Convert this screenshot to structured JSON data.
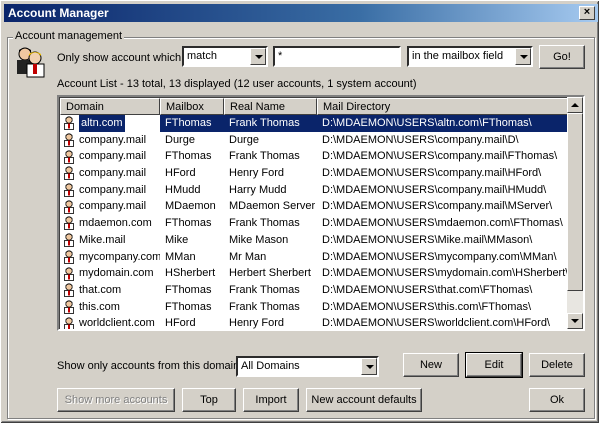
{
  "window": {
    "title": "Account Manager",
    "close_glyph": "×"
  },
  "group_title": "Account management",
  "filter": {
    "label": "Only show account which",
    "match_value": "match",
    "pattern_value": "*",
    "field_value": "in the mailbox field",
    "go_label": "Go!"
  },
  "list": {
    "summary": "Account List - 13 total, 13 displayed (12 user accounts, 1 system account)",
    "columns": [
      "Domain",
      "Mailbox",
      "Real Name",
      "Mail Directory"
    ],
    "rows": [
      {
        "domain": "altn.com",
        "mailbox": "FThomas",
        "name": "Frank Thomas",
        "dir": "D:\\MDAEMON\\USERS\\altn.com\\FThomas\\"
      },
      {
        "domain": "company.mail",
        "mailbox": "Durge",
        "name": "Durge",
        "dir": "D:\\MDAEMON\\USERS\\company.mail\\D\\"
      },
      {
        "domain": "company.mail",
        "mailbox": "FThomas",
        "name": "Frank Thomas",
        "dir": "D:\\MDAEMON\\USERS\\company.mail\\FThomas\\"
      },
      {
        "domain": "company.mail",
        "mailbox": "HFord",
        "name": "Henry Ford",
        "dir": "D:\\MDAEMON\\USERS\\company.mail\\HFord\\"
      },
      {
        "domain": "company.mail",
        "mailbox": "HMudd",
        "name": "Harry Mudd",
        "dir": "D:\\MDAEMON\\USERS\\company.mail\\HMudd\\"
      },
      {
        "domain": "company.mail",
        "mailbox": "MDaemon",
        "name": "MDaemon Server",
        "dir": "D:\\MDAEMON\\USERS\\company.mail\\MServer\\"
      },
      {
        "domain": "mdaemon.com",
        "mailbox": "FThomas",
        "name": "Frank Thomas",
        "dir": "D:\\MDAEMON\\USERS\\mdaemon.com\\FThomas\\"
      },
      {
        "domain": "Mike.mail",
        "mailbox": "Mike",
        "name": "Mike Mason",
        "dir": "D:\\MDAEMON\\USERS\\Mike.mail\\MMason\\"
      },
      {
        "domain": "mycompany.com",
        "mailbox": "MMan",
        "name": "Mr Man",
        "dir": "D:\\MDAEMON\\USERS\\mycompany.com\\MMan\\"
      },
      {
        "domain": "mydomain.com",
        "mailbox": "HSherbert",
        "name": "Herbert Sherbert",
        "dir": "D:\\MDAEMON\\USERS\\mydomain.com\\HSherbert\\"
      },
      {
        "domain": "that.com",
        "mailbox": "FThomas",
        "name": "Frank Thomas",
        "dir": "D:\\MDAEMON\\USERS\\that.com\\FThomas\\"
      },
      {
        "domain": "this.com",
        "mailbox": "FThomas",
        "name": "Frank Thomas",
        "dir": "D:\\MDAEMON\\USERS\\this.com\\FThomas\\"
      },
      {
        "domain": "worldclient.com",
        "mailbox": "HFord",
        "name": "Henry Ford",
        "dir": "D:\\MDAEMON\\USERS\\worldclient.com\\HFord\\"
      }
    ],
    "selected_index": 0
  },
  "domain_filter": {
    "label": "Show only accounts from this domain",
    "value": "All Domains"
  },
  "buttons": {
    "new": "New",
    "edit": "Edit",
    "delete": "Delete",
    "show_more": "Show more accounts",
    "top": "Top",
    "import": "Import",
    "new_defaults": "New account defaults",
    "ok": "Ok"
  },
  "colors": {
    "title_bar": "#0a246a",
    "selection": "#0a246a",
    "face": "#d4d0c8"
  },
  "icons": {
    "header": "users-group-icon",
    "row": "user-account-icon"
  }
}
